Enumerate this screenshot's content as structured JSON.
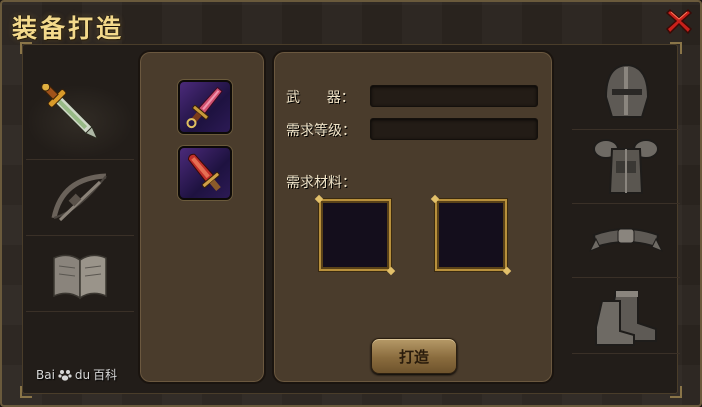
{
  "window": {
    "title": "装备打造"
  },
  "left_tabs": [
    {
      "icon": "sword-icon",
      "active": true
    },
    {
      "icon": "crossbow-icon",
      "active": false
    },
    {
      "icon": "book-icon",
      "active": false
    }
  ],
  "right_tabs": [
    {
      "icon": "helmet-icon"
    },
    {
      "icon": "armor-icon"
    },
    {
      "icon": "belt-icon"
    },
    {
      "icon": "boots-icon"
    }
  ],
  "weapon_list": [
    {
      "icon": "dagger-icon",
      "frame": "purple"
    },
    {
      "icon": "blade-icon",
      "frame": "purple"
    }
  ],
  "detail": {
    "weapon_label": "武      器：",
    "weapon_value": "",
    "level_label": "需求等级：",
    "level_value": "",
    "materials_label": "需求材料：",
    "forge_button": "打造"
  },
  "watermark": {
    "brand": "Bai",
    "brand_suffix": "du",
    "product": "百科"
  },
  "colors": {
    "title_gold": "#f3d98b",
    "panel_brown": "#4a3c2c",
    "slot_border_gold": "#b8903c",
    "close_red": "#c8201a"
  }
}
